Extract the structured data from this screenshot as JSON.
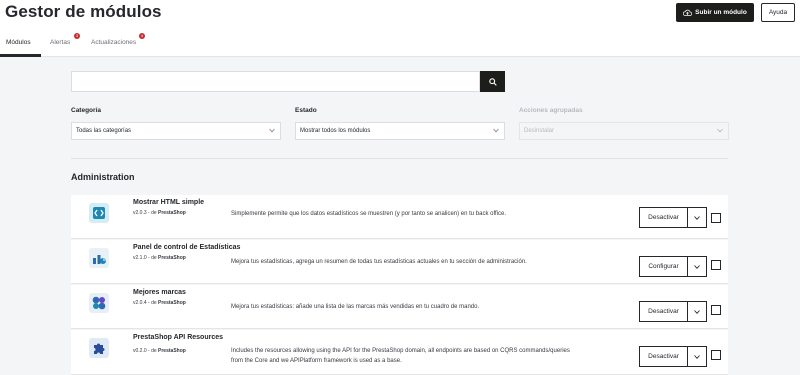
{
  "header": {
    "title": "Gestor de módulos",
    "upload_button": "Subir un módulo",
    "help_button": "Ayuda"
  },
  "tabs": [
    {
      "label": "Módulos",
      "active": true
    },
    {
      "label": "Alertas",
      "badge": "3"
    },
    {
      "label": "Actualizaciones",
      "badge": "4"
    }
  ],
  "search": {
    "value": "",
    "placeholder": ""
  },
  "filters": {
    "category": {
      "label": "Categoría",
      "value": "Todas las categorías"
    },
    "status": {
      "label": "Estado",
      "value": "Mostrar todos los módulos"
    },
    "bulk": {
      "label": "Acciones agrupadas",
      "value": "Desinstalar",
      "disabled": true
    }
  },
  "section": {
    "title": "Administration"
  },
  "modules": [
    {
      "name": "Mostrar HTML simple",
      "version": "v2.0.3 - de",
      "author": "PrestaShop",
      "description": "Simplemente permite que los datos estadísticos se muestren (y por tanto se analicen) en tu back office.",
      "action": "Desactivar",
      "icon": "html-stats-icon"
    },
    {
      "name": "Panel de control de Estadísticas",
      "version": "v2.1.0 - de",
      "author": "PrestaShop",
      "description": "Mejora tus estadísticas, agrega un resumen de todas tus estadísticas actuales en tu sección de administración.",
      "action": "Configurar",
      "icon": "stats-dashboard-icon"
    },
    {
      "name": "Mejores marcas",
      "version": "v2.0.4 - de",
      "author": "PrestaShop",
      "description": "Mejora tus estadísticas: añade una lista de las marcas más vendidas en tu cuadro de mando.",
      "action": "Desactivar",
      "icon": "best-brands-icon"
    },
    {
      "name": "PrestaShop API Resources",
      "version": "v0.2.0 - de",
      "author": "PrestaShop",
      "description": "Includes the resources allowing using the API for the PrestaShop domain, all endpoints are based on CQRS commands/queries from the Core and we APIPlatform framework is used as a base.",
      "action": "Desactivar",
      "icon": "puzzle-icon"
    }
  ]
}
